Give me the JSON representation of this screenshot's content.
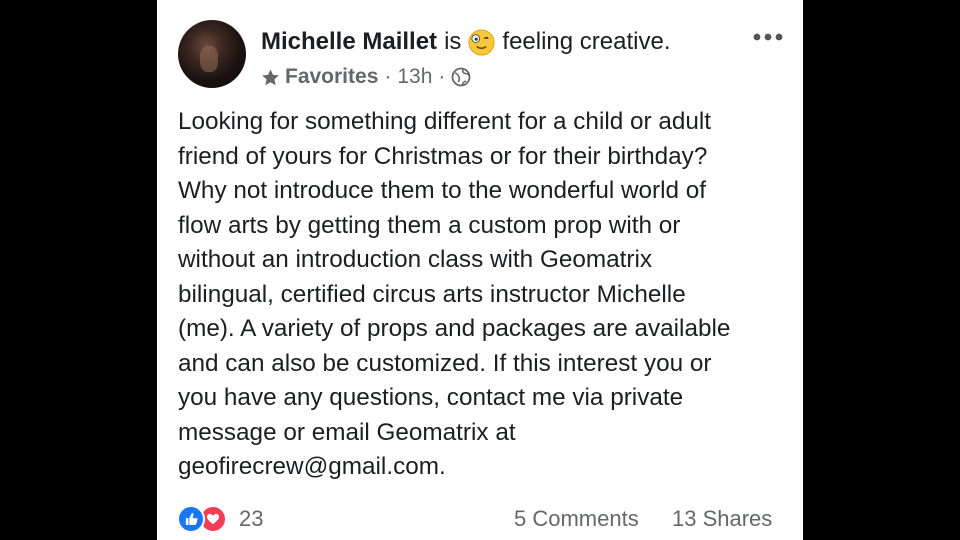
{
  "post": {
    "author": "Michelle Maillet",
    "is_word": "is",
    "feeling_emoji": "smiling-emoji",
    "feeling": "feeling creative.",
    "audience_label": "Favorites",
    "separator": "·",
    "time": "13h",
    "privacy_icon": "globe-icon",
    "more_icon": "more-dots-icon",
    "body_lines": [
      "Looking for something different for a child or adult",
      "friend of yours for Christmas or for their birthday?",
      "Why not introduce them to the wonderful world of",
      "flow arts by getting them a custom prop with or",
      "without an introduction class with Geomatrix",
      "bilingual, certified circus arts instructor Michelle",
      "(me). A variety of props and packages are available",
      "and can also be customized. If this interest you or",
      "you have any questions, contact me via private",
      "message or email Geomatrix at",
      "geofirecrew@gmail.com."
    ]
  },
  "footer": {
    "reaction_icons": [
      "like-icon",
      "love-icon"
    ],
    "reaction_count": "23",
    "comments": "5 Comments",
    "shares": "13 Shares"
  },
  "colors": {
    "background": "#000000",
    "card": "#ffffff",
    "text": "#1c1e21",
    "secondary_text": "#65676b",
    "like_blue": "#1877f2",
    "love_red": "#f33e58"
  }
}
